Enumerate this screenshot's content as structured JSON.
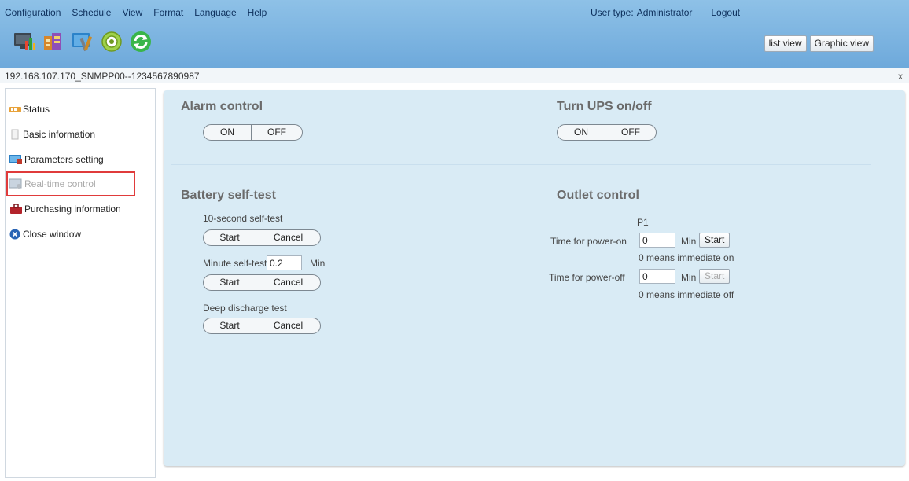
{
  "menu": [
    "Configuration",
    "Schedule",
    "View",
    "Format",
    "Language",
    "Help"
  ],
  "user": {
    "type_label": "User type:",
    "type_value": "Administrator",
    "logout": "Logout"
  },
  "toolbar_icons": [
    "monitor-chart-icon",
    "building-icon",
    "tools-icon",
    "gear-disc-icon",
    "refresh-icon"
  ],
  "view_buttons": {
    "list": "list view",
    "graphic": "Graphic view"
  },
  "device": {
    "name": "192.168.107.170_SNMPP00--1234567890987",
    "close": "x"
  },
  "sidebar": {
    "items": [
      {
        "label": "Status",
        "icon": "status-icon"
      },
      {
        "label": "Basic information",
        "icon": "info-icon"
      },
      {
        "label": "Parameters setting",
        "icon": "monitor-icon"
      },
      {
        "label": "Real-time control",
        "icon": "control-icon",
        "selected": true
      },
      {
        "label": "Purchasing information",
        "icon": "purchase-icon"
      },
      {
        "label": "Close window",
        "icon": "close-icon"
      }
    ]
  },
  "alarm": {
    "title": "Alarm control",
    "on": "ON",
    "off": "OFF"
  },
  "ups": {
    "title": "Turn UPS on/off",
    "on": "ON",
    "off": "OFF"
  },
  "battery": {
    "title": "Battery self-test",
    "ten_sec_label": "10-second self-test",
    "minute_label": "Minute self-test",
    "minute_value": "0.2",
    "minute_unit": "Min",
    "deep_label": "Deep discharge test",
    "start": "Start",
    "cancel": "Cancel"
  },
  "outlet": {
    "title": "Outlet control",
    "port": "P1",
    "on_label": "Time for power-on",
    "on_value": "0",
    "off_label": "Time for power-off",
    "off_value": "0",
    "unit": "Min",
    "start": "Start",
    "on_hint": "0 means immediate on",
    "off_hint": "0 means immediate off"
  },
  "colors": {
    "header": "#7fb5e2",
    "panel": "#d9ebf5",
    "highlight": "#e03b3b"
  }
}
